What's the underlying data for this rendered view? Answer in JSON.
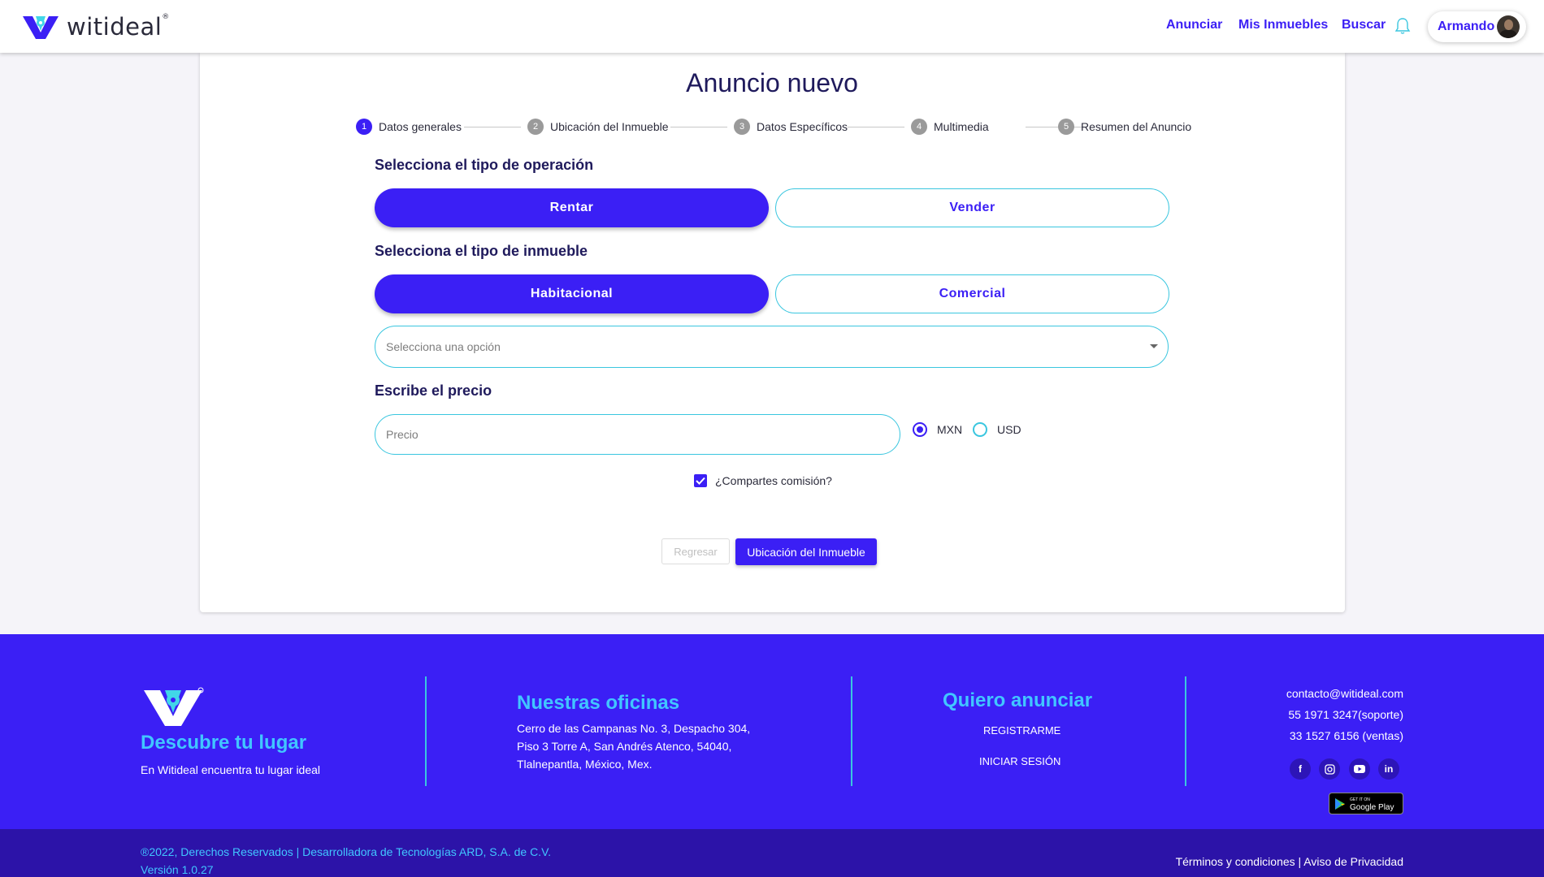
{
  "header": {
    "logo_text": "witideal",
    "logo_reg": "®",
    "nav": [
      "Anunciar",
      "Mis Inmuebles",
      "Buscar"
    ],
    "user_name": "Armando"
  },
  "form": {
    "title": "Anuncio nuevo",
    "steps": [
      {
        "num": "1",
        "label": "Datos generales"
      },
      {
        "num": "2",
        "label": "Ubicación del Inmueble"
      },
      {
        "num": "3",
        "label": "Datos Específicos"
      },
      {
        "num": "4",
        "label": "Multimedia"
      },
      {
        "num": "5",
        "label": "Resumen del Anuncio"
      }
    ],
    "operation_label": "Selecciona el tipo de operación",
    "operation_options": [
      "Rentar",
      "Vender"
    ],
    "property_label": "Selecciona el tipo de inmueble",
    "property_options": [
      "Habitacional",
      "Comercial"
    ],
    "select_placeholder": "Selecciona una opción",
    "price_label": "Escribe el precio",
    "price_placeholder": "Precio",
    "currency_options": [
      "MXN",
      "USD"
    ],
    "currency_selected": "MXN",
    "commission_label": "¿Compartes comisión?",
    "commission_checked": true,
    "back_button": "Regresar",
    "next_button": "Ubicación del Inmueble"
  },
  "footer": {
    "brand_heading": "Descubre tu lugar",
    "brand_text": "En Witideal encuentra tu lugar ideal",
    "offices_heading": "Nuestras oficinas",
    "offices_lines": [
      "Cerro de las Campanas No. 3, Despacho 304,",
      "Piso 3 Torre A, San Andrés Atenco, 54040,",
      "Tlalnepantla, México, Mex."
    ],
    "advertise_heading": "Quiero anunciar",
    "advertise_links": [
      "REGISTRARME",
      "INICIAR SESIÓN"
    ],
    "contact": [
      "contacto@witideal.com",
      "55 1971 3247(soporte)",
      "33 1527 6156 (ventas)"
    ],
    "social": [
      "f",
      "ig",
      "yt",
      "in"
    ],
    "gplay_small": "GET IT ON",
    "gplay_label": "Google Play",
    "copyright": "®2022, Derechos Reservados | Desarrolladora de Tecnologías ARD, S.A. de C.V.",
    "version": "Versión 1.0.27",
    "legal": "Términos y condiciones | Aviso de Privacidad"
  },
  "colors": {
    "primary": "#3b1ff5",
    "accent": "#3ac6df",
    "footer_heading": "#41c6ff",
    "footer_bottom": "#2c13a8"
  }
}
